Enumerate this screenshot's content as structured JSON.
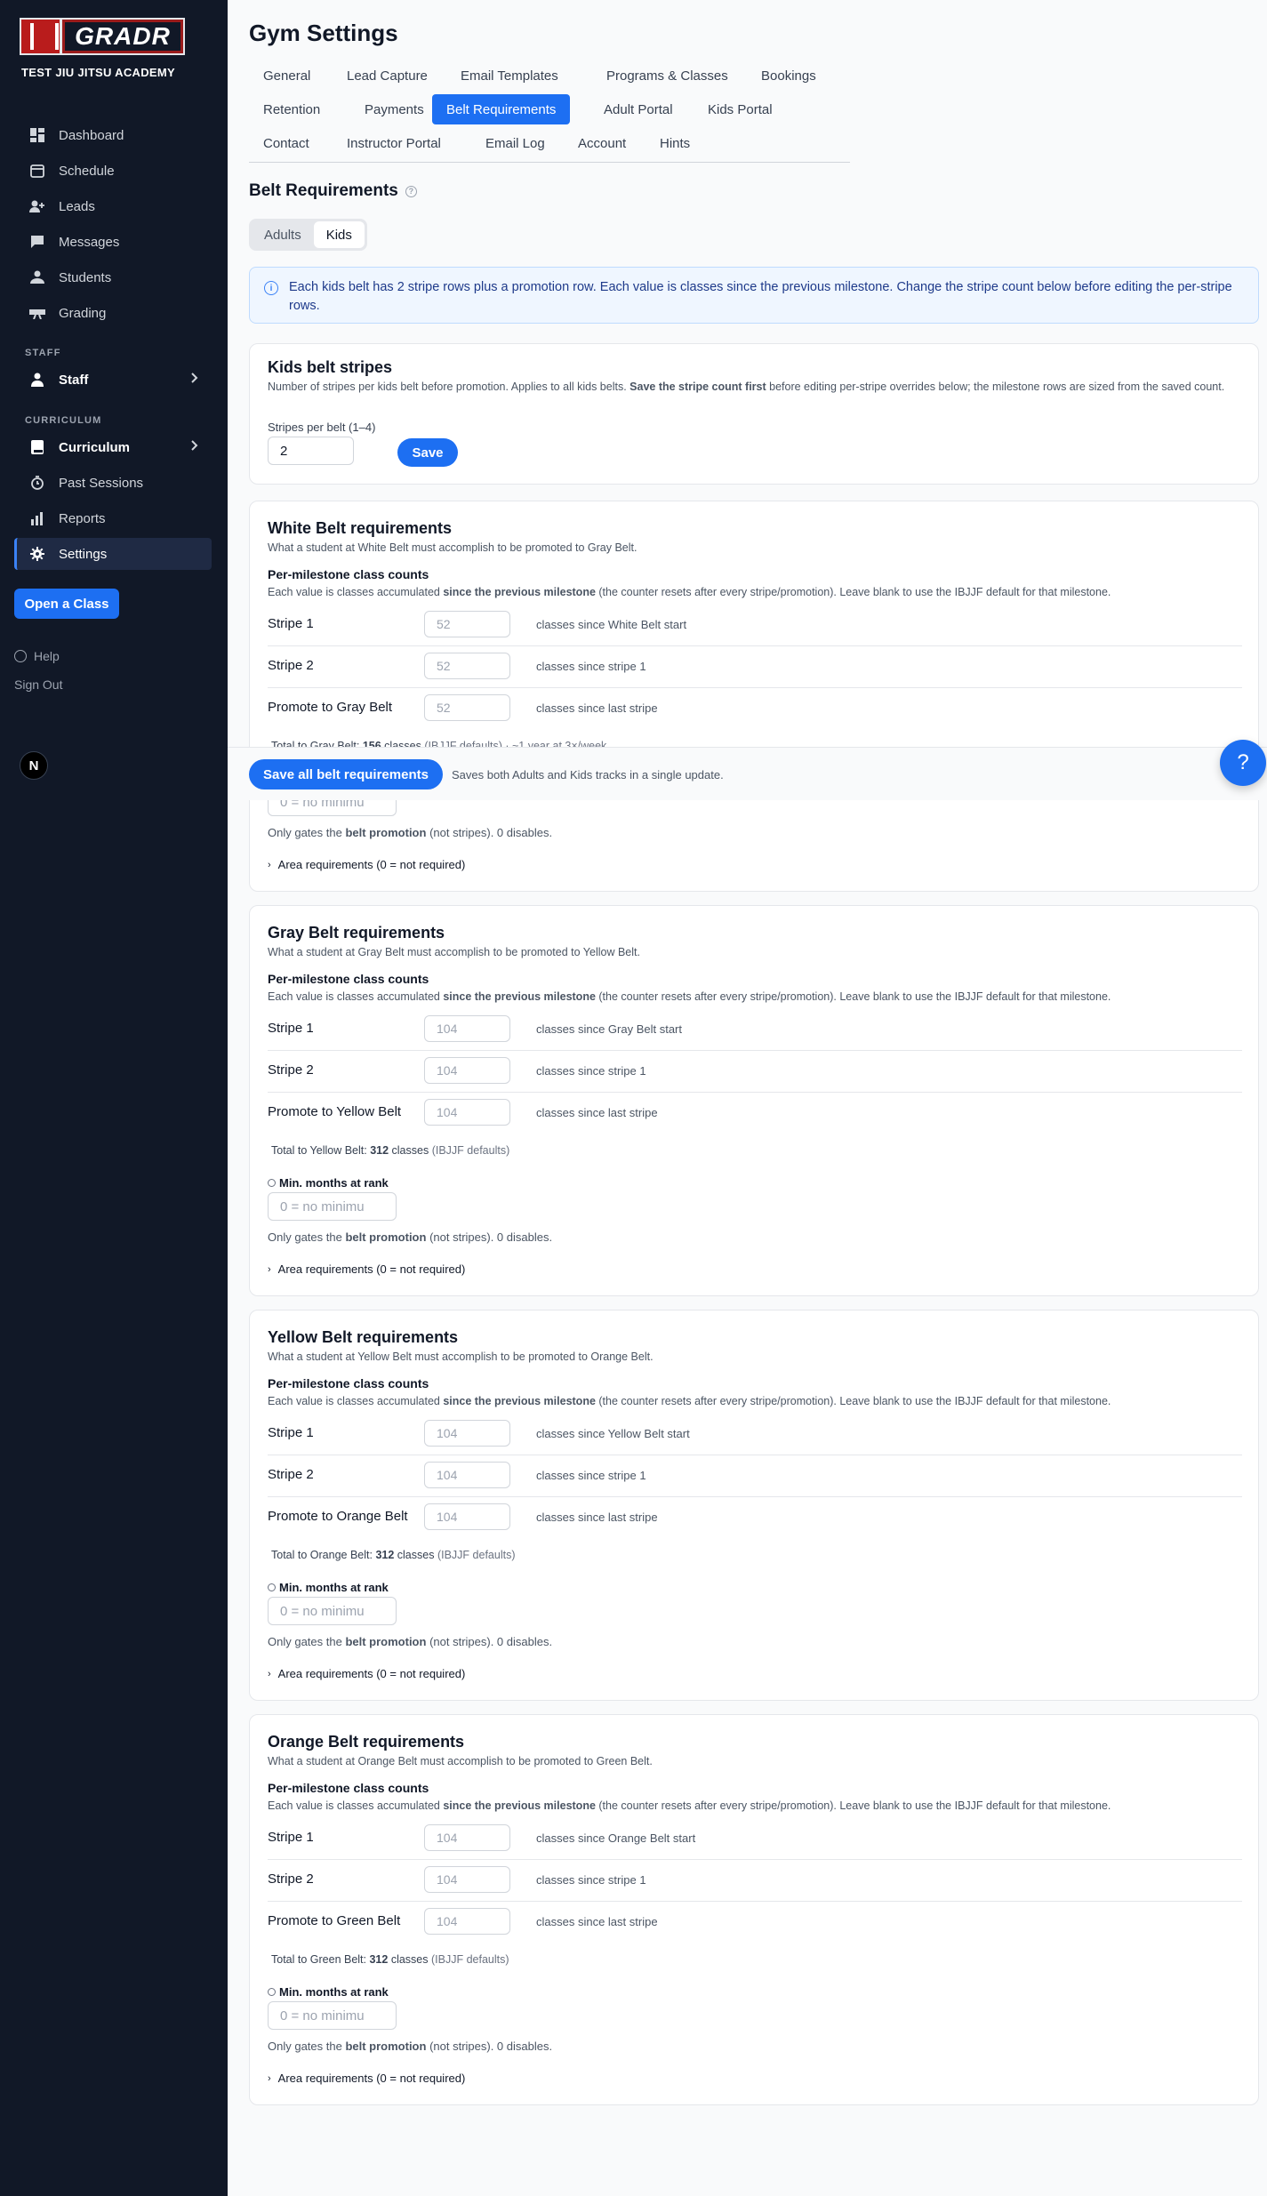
{
  "sidebar": {
    "logo_text": "GRADR",
    "academy": "TEST JIU JITSU ACADEMY",
    "nav": [
      {
        "label": "Dashboard",
        "icon": "dashboard-icon"
      },
      {
        "label": "Schedule",
        "icon": "calendar-icon"
      },
      {
        "label": "Leads",
        "icon": "user-plus-icon"
      },
      {
        "label": "Messages",
        "icon": "chat-icon"
      },
      {
        "label": "Students",
        "icon": "users-icon"
      },
      {
        "label": "Grading",
        "icon": "belt-icon"
      }
    ],
    "staff_label": "STAFF",
    "staff_item": "Staff",
    "curriculum_label": "CURRICULUM",
    "curriculum_item": "Curriculum",
    "nav2": [
      {
        "label": "Past Sessions",
        "icon": "clock-icon"
      },
      {
        "label": "Reports",
        "icon": "bar-chart-icon"
      },
      {
        "label": "Settings",
        "icon": "gear-icon"
      }
    ],
    "open_class": "Open a Class",
    "help": "Help",
    "sign_out": "Sign Out",
    "badge": "N"
  },
  "page": {
    "title": "Gym Settings",
    "tabs": [
      "General",
      "Lead Capture",
      "Email Templates",
      "Programs & Classes",
      "Bookings",
      "Retention",
      "Payments",
      "Belt Requirements",
      "Adult Portal",
      "Kids Portal",
      "Contact",
      "Instructor Portal",
      "Email Log",
      "Account",
      "Hints"
    ],
    "active_tab": "Belt Requirements",
    "section_title": "Belt Requirements",
    "segments": [
      "Adults",
      "Kids"
    ],
    "active_segment": "Kids",
    "info": "Each kids belt has 2 stripe rows plus a promotion row. Each value is classes since the previous milestone. Change the stripe count below before editing the per-stripe rows."
  },
  "stripes_card": {
    "title": "Kids belt stripes",
    "desc_a": "Number of stripes per kids belt before promotion. Applies to all kids belts. ",
    "desc_b": "Save the stripe count first",
    "desc_c": " before editing per-stripe overrides below; the milestone rows are sized from the saved count.",
    "field_label": "Stripes per belt (1–4)",
    "field_value": "2",
    "save": "Save"
  },
  "common": {
    "per_milestone": "Per-milestone class counts",
    "pm_a": "Each value is classes accumulated ",
    "pm_b": "since the previous milestone",
    "pm_c": " (the counter resets after every stripe/promotion). Leave blank to use the IBJJF default for that milestone.",
    "stripe1": "Stripe 1",
    "stripe2": "Stripe 2",
    "since_stripe1": "classes since stripe 1",
    "since_last": "classes since last stripe",
    "min_months": "Min. months at rank",
    "min_placeholder": "0 = no minimu",
    "gates_a": "Only gates the ",
    "gates_b": "belt promotion",
    "gates_c": " (not stripes). 0 disables.",
    "area": "Area requirements (0 = not required)",
    "classes": "classes",
    "ibjjf": "(IBJJF defaults)"
  },
  "belts": [
    {
      "title": "White Belt requirements",
      "desc": "What a student at White Belt must accomplish to be promoted to Gray Belt.",
      "s1": "52",
      "s2": "52",
      "p": "52",
      "start": "classes since White Belt start",
      "promote": "Promote to Gray Belt",
      "total_label": "Total to Gray Belt: ",
      "total": "156",
      "extra": "· ~1 year at 3×/week"
    },
    {
      "title": "Gray Belt requirements",
      "desc": "What a student at Gray Belt must accomplish to be promoted to Yellow Belt.",
      "s1": "104",
      "s2": "104",
      "p": "104",
      "start": "classes since Gray Belt start",
      "promote": "Promote to Yellow Belt",
      "total_label": "Total to Yellow Belt: ",
      "total": "312"
    },
    {
      "title": "Yellow Belt requirements",
      "desc": "What a student at Yellow Belt must accomplish to be promoted to Orange Belt.",
      "s1": "104",
      "s2": "104",
      "p": "104",
      "start": "classes since Yellow Belt start",
      "promote": "Promote to Orange Belt",
      "total_label": "Total to Orange Belt: ",
      "total": "312"
    },
    {
      "title": "Orange Belt requirements",
      "desc": "What a student at Orange Belt must accomplish to be promoted to Green Belt.",
      "s1": "104",
      "s2": "104",
      "p": "104",
      "start": "classes since Orange Belt start",
      "promote": "Promote to Green Belt",
      "total_label": "Total to Green Belt: ",
      "total": "312"
    }
  ],
  "sticky": {
    "save_all": "Save all belt requirements",
    "note": "Saves both Adults and Kids tracks in a single update."
  },
  "help_fab": "?"
}
